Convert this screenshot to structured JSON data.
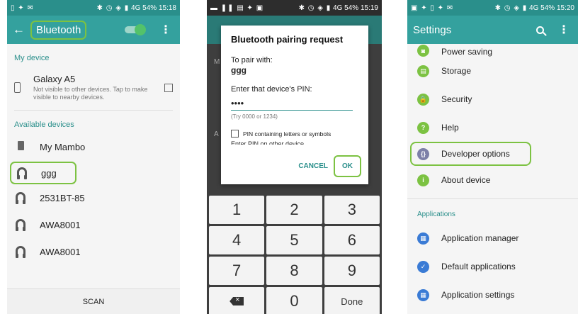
{
  "colors": {
    "accent": "#34a19e",
    "highlight": "#7cc242",
    "status_teal": "#2a8f8b"
  },
  "screen1": {
    "status_time": "15:18",
    "status_battery": "54%",
    "status_net": "4G",
    "title": "Bluetooth",
    "my_device_header": "My device",
    "device_name": "Galaxy A5",
    "device_sub": "Not visible to other devices. Tap to make visible to nearby devices.",
    "available_header": "Available devices",
    "devices": [
      {
        "name": "My Mambo",
        "icon": "speaker-icon"
      },
      {
        "name": "ggg",
        "icon": "headphones-icon"
      },
      {
        "name": "2531BT-85",
        "icon": "headphones-icon"
      },
      {
        "name": "AWA8001",
        "icon": "headphones-icon"
      },
      {
        "name": "AWA8001",
        "icon": "headphones-icon"
      }
    ],
    "scan_label": "SCAN"
  },
  "screen2": {
    "status_time": "15:19",
    "status_battery": "54%",
    "status_net": "4G",
    "dialog_title": "Bluetooth pairing request",
    "pair_label": "To pair with:",
    "pair_name": "ggg",
    "pin_label": "Enter that device's PIN:",
    "pin_value": "••••",
    "hint": "(Try 0000 or 1234)",
    "checkbox_label": "PIN containing letters or symbols",
    "cut_text": "Enter PIN on other device",
    "cancel_label": "CANCEL",
    "ok_label": "OK",
    "bg_letters": {
      "m": "M",
      "a": "A"
    },
    "keys": [
      "1",
      "2",
      "3",
      "4",
      "5",
      "6",
      "7",
      "8",
      "9",
      "0",
      "Done"
    ]
  },
  "screen3": {
    "status_time": "15:20",
    "status_battery": "54%",
    "status_net": "4G",
    "title": "Settings",
    "items": [
      {
        "label": "Power saving",
        "color": "#7cc242",
        "glyph": "◙"
      },
      {
        "label": "Storage",
        "color": "#7cc242",
        "glyph": "▤"
      },
      {
        "label": "Security",
        "color": "#7cc242",
        "glyph": "🔒"
      },
      {
        "label": "Help",
        "color": "#7cc242",
        "glyph": "?"
      },
      {
        "label": "Developer options",
        "color": "#7d7fa8",
        "glyph": "{}"
      },
      {
        "label": "About device",
        "color": "#7cc242",
        "glyph": "i"
      }
    ],
    "apps_header": "Applications",
    "apps": [
      {
        "label": "Application manager",
        "color": "#3a7bd5",
        "glyph": "▦"
      },
      {
        "label": "Default applications",
        "color": "#3a7bd5",
        "glyph": "✓"
      },
      {
        "label": "Application settings",
        "color": "#3a7bd5",
        "glyph": "▦"
      }
    ]
  }
}
